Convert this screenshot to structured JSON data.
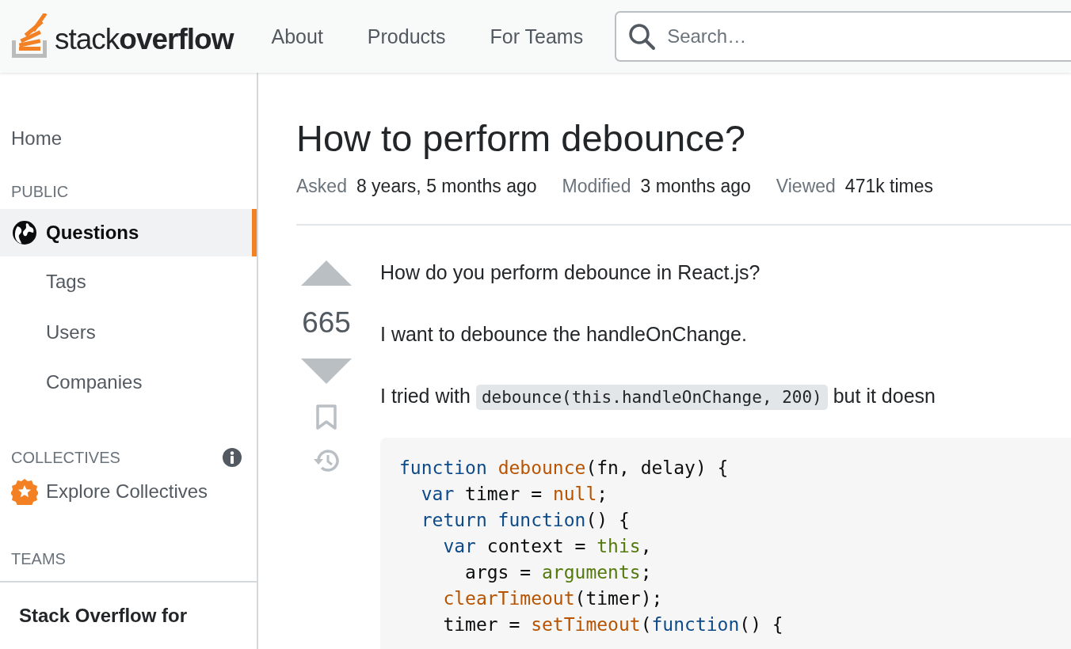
{
  "header": {
    "logo_text": "stack**overflow**",
    "nav": [
      {
        "label": "About",
        "selected": false
      },
      {
        "label": "Products",
        "selected": false
      },
      {
        "label": "For Teams",
        "selected": false
      }
    ],
    "search": {
      "placeholder": "Search…"
    }
  },
  "sidebar": {
    "home": {
      "label": "Home",
      "selected": false
    },
    "public": {
      "heading": "PUBLIC",
      "items": [
        {
          "label": "Questions",
          "selected": true,
          "children": [
            {
              "label": "Tags",
              "selected": false
            },
            {
              "label": "Users",
              "selected": false
            },
            {
              "label": "Companies",
              "selected": false
            }
          ]
        }
      ]
    },
    "collectives": {
      "heading": "COLLECTIVES",
      "items": [
        {
          "label": "Explore Collectives",
          "selected": false
        }
      ]
    },
    "teams": {
      "heading": "TEAMS",
      "card_title": "Stack Overflow for"
    }
  },
  "question": {
    "title": "How to perform debounce?",
    "meta": [
      {
        "label": "Asked",
        "value": "8 years, 5 months ago"
      },
      {
        "label": "Modified",
        "value": "3 months ago"
      },
      {
        "label": "Viewed",
        "value": "471k times"
      }
    ],
    "score": "665",
    "paragraphs": [
      [
        {
          "kind": "text",
          "text": "How do you perform debounce in React.js?"
        }
      ],
      [
        {
          "kind": "text",
          "text": "I want to debounce the handleOnChange."
        }
      ],
      [
        {
          "kind": "text",
          "text": "I tried with "
        },
        {
          "kind": "code",
          "text": "debounce(this.handleOnChange, 200)"
        },
        {
          "kind": "text",
          "text": " but it doesn"
        }
      ]
    ],
    "code_lines": [
      [
        {
          "kind": "kw",
          "text": "function"
        },
        {
          "kind": "fn",
          "text": " debounce"
        },
        {
          "kind": "plain",
          "text": "(fn, delay) {"
        }
      ],
      [
        {
          "kind": "kw",
          "text": "  var"
        },
        {
          "kind": "plain",
          "text": " timer = "
        },
        {
          "kind": "fn",
          "text": "null"
        },
        {
          "kind": "plain",
          "text": ";"
        }
      ],
      [
        {
          "kind": "kw",
          "text": "  return function"
        },
        {
          "kind": "plain",
          "text": "() {"
        }
      ],
      [
        {
          "kind": "kw",
          "text": "    var"
        },
        {
          "kind": "plain",
          "text": " context = "
        },
        {
          "kind": "lit",
          "text": "this"
        },
        {
          "kind": "plain",
          "text": ","
        }
      ],
      [
        {
          "kind": "plain",
          "text": "      args = "
        },
        {
          "kind": "lit",
          "text": "arguments"
        },
        {
          "kind": "plain",
          "text": ";"
        }
      ],
      [
        {
          "kind": "fn",
          "text": "    clearTimeout"
        },
        {
          "kind": "plain",
          "text": "(timer);"
        }
      ],
      [
        {
          "kind": "plain",
          "text": "    timer = "
        },
        {
          "kind": "fn",
          "text": "setTimeout"
        },
        {
          "kind": "plain",
          "text": "("
        },
        {
          "kind": "kw",
          "text": "function"
        },
        {
          "kind": "plain",
          "text": "() {"
        }
      ]
    ]
  }
}
